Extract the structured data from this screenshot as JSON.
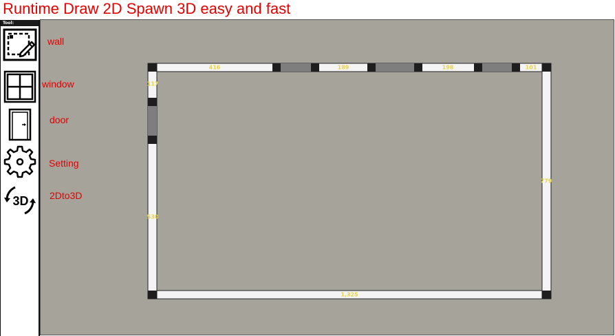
{
  "app": {
    "title": "Runtime Draw 2D Spawn 3D easy and fast"
  },
  "toolbar": {
    "header": "Tool:",
    "tools": [
      {
        "label": "wall",
        "icon": "wall-draw-icon"
      },
      {
        "label": "window",
        "icon": "window-icon"
      },
      {
        "label": "door",
        "icon": "door-icon"
      },
      {
        "label": "Setting",
        "icon": "gear-icon"
      },
      {
        "label": "2Dto3D",
        "icon": "rotate-3d-icon"
      }
    ]
  },
  "room": {
    "dimensions": {
      "top_1": "416",
      "top_2": "189",
      "top_3": "198",
      "top_4": "101",
      "left_top": "117",
      "left_main": "530",
      "right": "779",
      "bottom": "1,325"
    }
  },
  "colors": {
    "title": "#e60000",
    "canvas": "#a6a39b",
    "wall_fill": "#f4f4f4",
    "joint": "#1e1e1e",
    "opening": "#7e7e7e",
    "dimension_text": "#e8d34a"
  }
}
